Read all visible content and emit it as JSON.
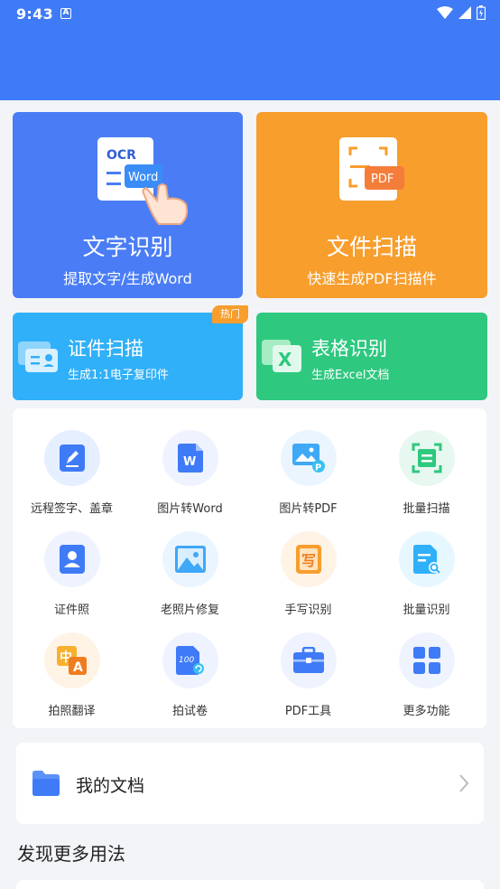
{
  "status_bar": {
    "time": "9:43",
    "notification_letter": "A"
  },
  "feature_cards": {
    "ocr": {
      "title": "文字识别",
      "subtitle": "提取文字/生成Word",
      "icon_text_top": "OCR",
      "icon_text_tag": "Word",
      "color": "#4a7df5"
    },
    "scan": {
      "title": "文件扫描",
      "subtitle": "快速生成PDF扫描件",
      "icon_text_tag": "PDF",
      "color": "#f79e2d"
    },
    "id_scan": {
      "title": "证件扫描",
      "subtitle": "生成1:1电子复印件",
      "badge": "热门",
      "color": "#30b0f8"
    },
    "table": {
      "title": "表格识别",
      "subtitle": "生成Excel文档",
      "icon_text": "X",
      "color": "#2ec87f"
    }
  },
  "tools": [
    {
      "label": "远程签字、盖章",
      "icon": "pen-sign-icon"
    },
    {
      "label": "图片转Word",
      "icon": "word-doc-icon",
      "glyph": "W"
    },
    {
      "label": "图片转PDF",
      "icon": "image-pdf-icon",
      "glyph": "P"
    },
    {
      "label": "批量扫描",
      "icon": "batch-scan-icon"
    },
    {
      "label": "证件照",
      "icon": "id-photo-icon"
    },
    {
      "label": "老照片修复",
      "icon": "photo-restore-icon"
    },
    {
      "label": "手写识别",
      "icon": "handwriting-icon",
      "glyph": "写"
    },
    {
      "label": "批量识别",
      "icon": "batch-recognize-icon"
    },
    {
      "label": "拍照翻译",
      "icon": "translate-icon",
      "glyph": "中",
      "glyph2": "A"
    },
    {
      "label": "拍试卷",
      "icon": "test-paper-icon",
      "glyph": "100"
    },
    {
      "label": "PDF工具",
      "icon": "pdf-toolbox-icon"
    },
    {
      "label": "更多功能",
      "icon": "more-grid-icon"
    }
  ],
  "my_docs": {
    "label": "我的文档",
    "icon": "folder-icon"
  },
  "discover": {
    "title": "发现更多用法"
  }
}
